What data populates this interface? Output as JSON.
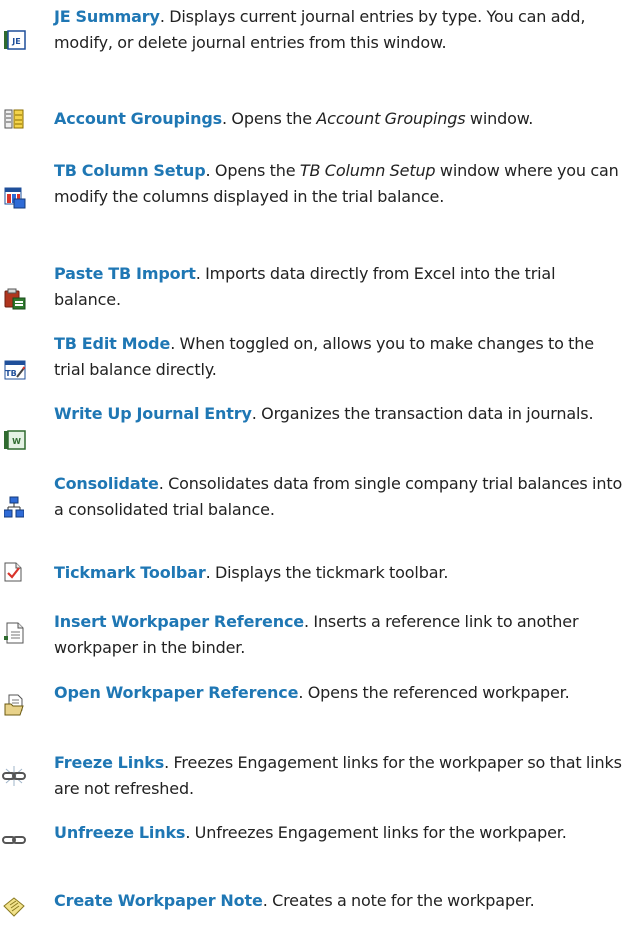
{
  "entries": [
    {
      "term": "JE Summary",
      "desc": ". Displays current journal entries by type. You can add, modify, or delete journal entries from this window.",
      "icon": "journal-entry-summary-icon"
    },
    {
      "term": "Account Groupings",
      "desc_before": ". Opens the ",
      "desc_em": "Account Groupings",
      "desc_after": " window.",
      "icon": "account-groupings-icon"
    },
    {
      "term": "TB Column Setup",
      "desc_before": ". Opens the ",
      "desc_em": "TB Column Setup",
      "desc_after": " window where you can modify the columns displayed in the trial balance.",
      "icon": "tb-column-setup-icon"
    },
    {
      "term": "Paste TB Import",
      "desc": ". Imports data directly from Excel into the trial balance.",
      "icon": "paste-import-icon"
    },
    {
      "term": "TB Edit Mode",
      "desc": ". When toggled on, allows you to make changes to the trial balance directly.",
      "icon": "tb-edit-mode-icon"
    },
    {
      "term": "Write Up Journal Entry",
      "desc": ". Organizes the transaction data in journals.",
      "icon": "write-up-journal-icon"
    },
    {
      "term": "Consolidate",
      "desc": ". Consolidates data from single company trial balances into a consolidated trial balance.",
      "icon": "consolidate-icon"
    },
    {
      "term": "Tickmark Toolbar",
      "desc": ". Displays the tickmark toolbar.",
      "icon": "tickmark-icon"
    },
    {
      "term": "Insert Workpaper Reference",
      "desc": ". Inserts a reference link to another workpaper in the binder.",
      "icon": "insert-reference-icon"
    },
    {
      "term": "Open Workpaper Reference",
      "desc": ". Opens the referenced workpaper.",
      "icon": "open-reference-icon"
    },
    {
      "term": "Freeze Links",
      "desc": ". Freezes Engagement links for the workpaper so that links are not refreshed.",
      "icon": "freeze-links-icon"
    },
    {
      "term": "Unfreeze Links",
      "desc": ". Unfreezes Engagement links for the workpaper.",
      "icon": "unfreeze-links-icon"
    },
    {
      "term": "Create Workpaper Note",
      "desc": ". Creates a note for the workpaper.",
      "icon": "workpaper-note-icon"
    }
  ]
}
